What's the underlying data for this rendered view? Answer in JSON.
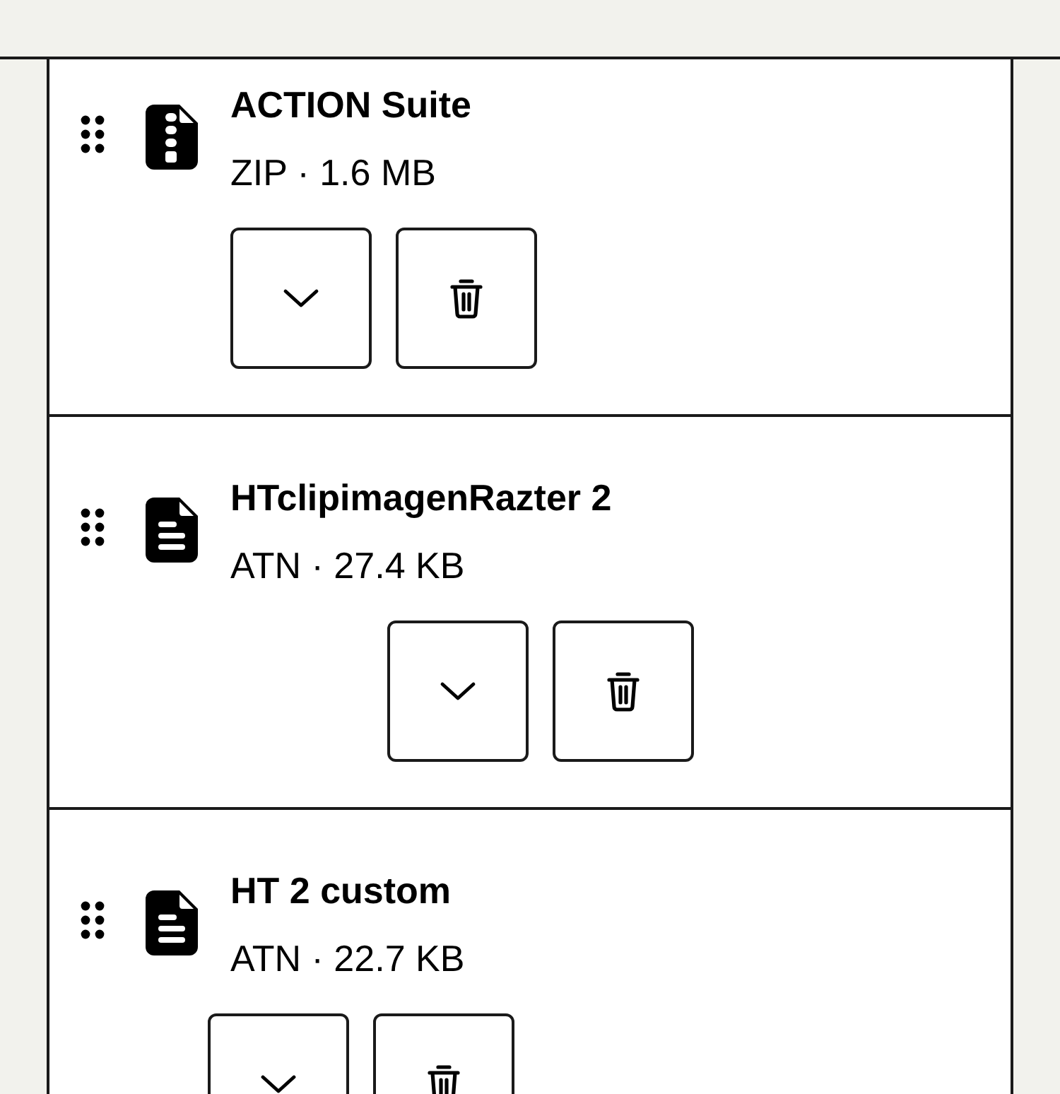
{
  "files": [
    {
      "name": "ACTION Suite",
      "meta": "ZIP · 1.6 MB",
      "kind": "zip"
    },
    {
      "name": "HTclipimagenRazter 2",
      "meta": "ATN · 27.4 KB",
      "kind": "document"
    },
    {
      "name": "HT 2 custom",
      "meta": "ATN · 22.7 KB",
      "kind": "document"
    }
  ]
}
